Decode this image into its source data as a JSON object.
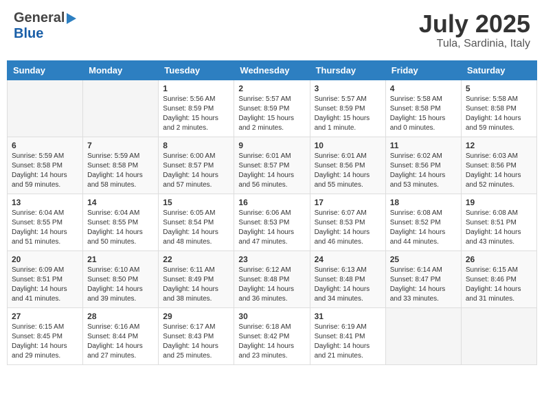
{
  "header": {
    "logo_general": "General",
    "logo_blue": "Blue",
    "title": "July 2025",
    "location": "Tula, Sardinia, Italy"
  },
  "calendar": {
    "days_of_week": [
      "Sunday",
      "Monday",
      "Tuesday",
      "Wednesday",
      "Thursday",
      "Friday",
      "Saturday"
    ],
    "weeks": [
      [
        {
          "day": "",
          "info": ""
        },
        {
          "day": "",
          "info": ""
        },
        {
          "day": "1",
          "info": "Sunrise: 5:56 AM\nSunset: 8:59 PM\nDaylight: 15 hours\nand 2 minutes."
        },
        {
          "day": "2",
          "info": "Sunrise: 5:57 AM\nSunset: 8:59 PM\nDaylight: 15 hours\nand 2 minutes."
        },
        {
          "day": "3",
          "info": "Sunrise: 5:57 AM\nSunset: 8:59 PM\nDaylight: 15 hours\nand 1 minute."
        },
        {
          "day": "4",
          "info": "Sunrise: 5:58 AM\nSunset: 8:58 PM\nDaylight: 15 hours\nand 0 minutes."
        },
        {
          "day": "5",
          "info": "Sunrise: 5:58 AM\nSunset: 8:58 PM\nDaylight: 14 hours\nand 59 minutes."
        }
      ],
      [
        {
          "day": "6",
          "info": "Sunrise: 5:59 AM\nSunset: 8:58 PM\nDaylight: 14 hours\nand 59 minutes."
        },
        {
          "day": "7",
          "info": "Sunrise: 5:59 AM\nSunset: 8:58 PM\nDaylight: 14 hours\nand 58 minutes."
        },
        {
          "day": "8",
          "info": "Sunrise: 6:00 AM\nSunset: 8:57 PM\nDaylight: 14 hours\nand 57 minutes."
        },
        {
          "day": "9",
          "info": "Sunrise: 6:01 AM\nSunset: 8:57 PM\nDaylight: 14 hours\nand 56 minutes."
        },
        {
          "day": "10",
          "info": "Sunrise: 6:01 AM\nSunset: 8:56 PM\nDaylight: 14 hours\nand 55 minutes."
        },
        {
          "day": "11",
          "info": "Sunrise: 6:02 AM\nSunset: 8:56 PM\nDaylight: 14 hours\nand 53 minutes."
        },
        {
          "day": "12",
          "info": "Sunrise: 6:03 AM\nSunset: 8:56 PM\nDaylight: 14 hours\nand 52 minutes."
        }
      ],
      [
        {
          "day": "13",
          "info": "Sunrise: 6:04 AM\nSunset: 8:55 PM\nDaylight: 14 hours\nand 51 minutes."
        },
        {
          "day": "14",
          "info": "Sunrise: 6:04 AM\nSunset: 8:55 PM\nDaylight: 14 hours\nand 50 minutes."
        },
        {
          "day": "15",
          "info": "Sunrise: 6:05 AM\nSunset: 8:54 PM\nDaylight: 14 hours\nand 48 minutes."
        },
        {
          "day": "16",
          "info": "Sunrise: 6:06 AM\nSunset: 8:53 PM\nDaylight: 14 hours\nand 47 minutes."
        },
        {
          "day": "17",
          "info": "Sunrise: 6:07 AM\nSunset: 8:53 PM\nDaylight: 14 hours\nand 46 minutes."
        },
        {
          "day": "18",
          "info": "Sunrise: 6:08 AM\nSunset: 8:52 PM\nDaylight: 14 hours\nand 44 minutes."
        },
        {
          "day": "19",
          "info": "Sunrise: 6:08 AM\nSunset: 8:51 PM\nDaylight: 14 hours\nand 43 minutes."
        }
      ],
      [
        {
          "day": "20",
          "info": "Sunrise: 6:09 AM\nSunset: 8:51 PM\nDaylight: 14 hours\nand 41 minutes."
        },
        {
          "day": "21",
          "info": "Sunrise: 6:10 AM\nSunset: 8:50 PM\nDaylight: 14 hours\nand 39 minutes."
        },
        {
          "day": "22",
          "info": "Sunrise: 6:11 AM\nSunset: 8:49 PM\nDaylight: 14 hours\nand 38 minutes."
        },
        {
          "day": "23",
          "info": "Sunrise: 6:12 AM\nSunset: 8:48 PM\nDaylight: 14 hours\nand 36 minutes."
        },
        {
          "day": "24",
          "info": "Sunrise: 6:13 AM\nSunset: 8:48 PM\nDaylight: 14 hours\nand 34 minutes."
        },
        {
          "day": "25",
          "info": "Sunrise: 6:14 AM\nSunset: 8:47 PM\nDaylight: 14 hours\nand 33 minutes."
        },
        {
          "day": "26",
          "info": "Sunrise: 6:15 AM\nSunset: 8:46 PM\nDaylight: 14 hours\nand 31 minutes."
        }
      ],
      [
        {
          "day": "27",
          "info": "Sunrise: 6:15 AM\nSunset: 8:45 PM\nDaylight: 14 hours\nand 29 minutes."
        },
        {
          "day": "28",
          "info": "Sunrise: 6:16 AM\nSunset: 8:44 PM\nDaylight: 14 hours\nand 27 minutes."
        },
        {
          "day": "29",
          "info": "Sunrise: 6:17 AM\nSunset: 8:43 PM\nDaylight: 14 hours\nand 25 minutes."
        },
        {
          "day": "30",
          "info": "Sunrise: 6:18 AM\nSunset: 8:42 PM\nDaylight: 14 hours\nand 23 minutes."
        },
        {
          "day": "31",
          "info": "Sunrise: 6:19 AM\nSunset: 8:41 PM\nDaylight: 14 hours\nand 21 minutes."
        },
        {
          "day": "",
          "info": ""
        },
        {
          "day": "",
          "info": ""
        }
      ]
    ]
  }
}
